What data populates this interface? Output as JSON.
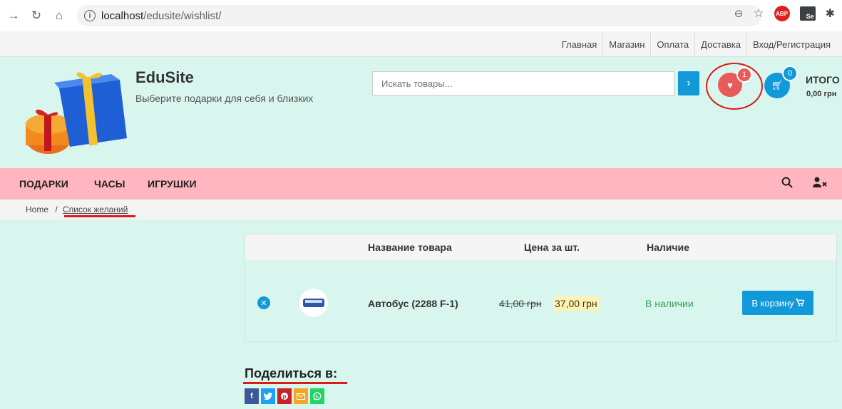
{
  "browser": {
    "url_host": "localhost",
    "url_path": "/edusite/wishlist/"
  },
  "top_links": [
    "Главная",
    "Магазин",
    "Оплата",
    "Доставка",
    "Вход/Регистрация"
  ],
  "header": {
    "site_title": "EduSite",
    "tagline": "Выберите подарки для себя и близких",
    "search_placeholder": "Искать товары...",
    "wishlist_count": "1",
    "cart_count": "0",
    "cart_total_label": "ИТОГО",
    "cart_total_value": "0,00 грн"
  },
  "nav": {
    "items": [
      "ПОДАРКИ",
      "ЧАСЫ",
      "ИГРУШКИ"
    ]
  },
  "breadcrumb": {
    "home": "Home",
    "separator": "/",
    "current": "Список желаний"
  },
  "wishlist": {
    "headers": {
      "name": "Название товара",
      "price": "Цена за шт.",
      "stock": "Наличие"
    },
    "rows": [
      {
        "name": "Автобус (2288 F-1)",
        "old_price": "41,00 грн",
        "new_price": "37,00 грн",
        "stock": "В наличии",
        "button": "В корзину"
      }
    ]
  },
  "share": {
    "title": "Поделиться в:",
    "networks": [
      "facebook-icon",
      "twitter-icon",
      "pinterest-icon",
      "email-icon",
      "whatsapp-icon"
    ]
  },
  "colors": {
    "accent_blue": "#1199d9",
    "header_bg": "#d8f6ee",
    "nav_bg": "#ffb6c1",
    "wishlist_red": "#e95a5a",
    "stock_green": "#3aa05b",
    "annotation_red": "#dd1a1a"
  }
}
